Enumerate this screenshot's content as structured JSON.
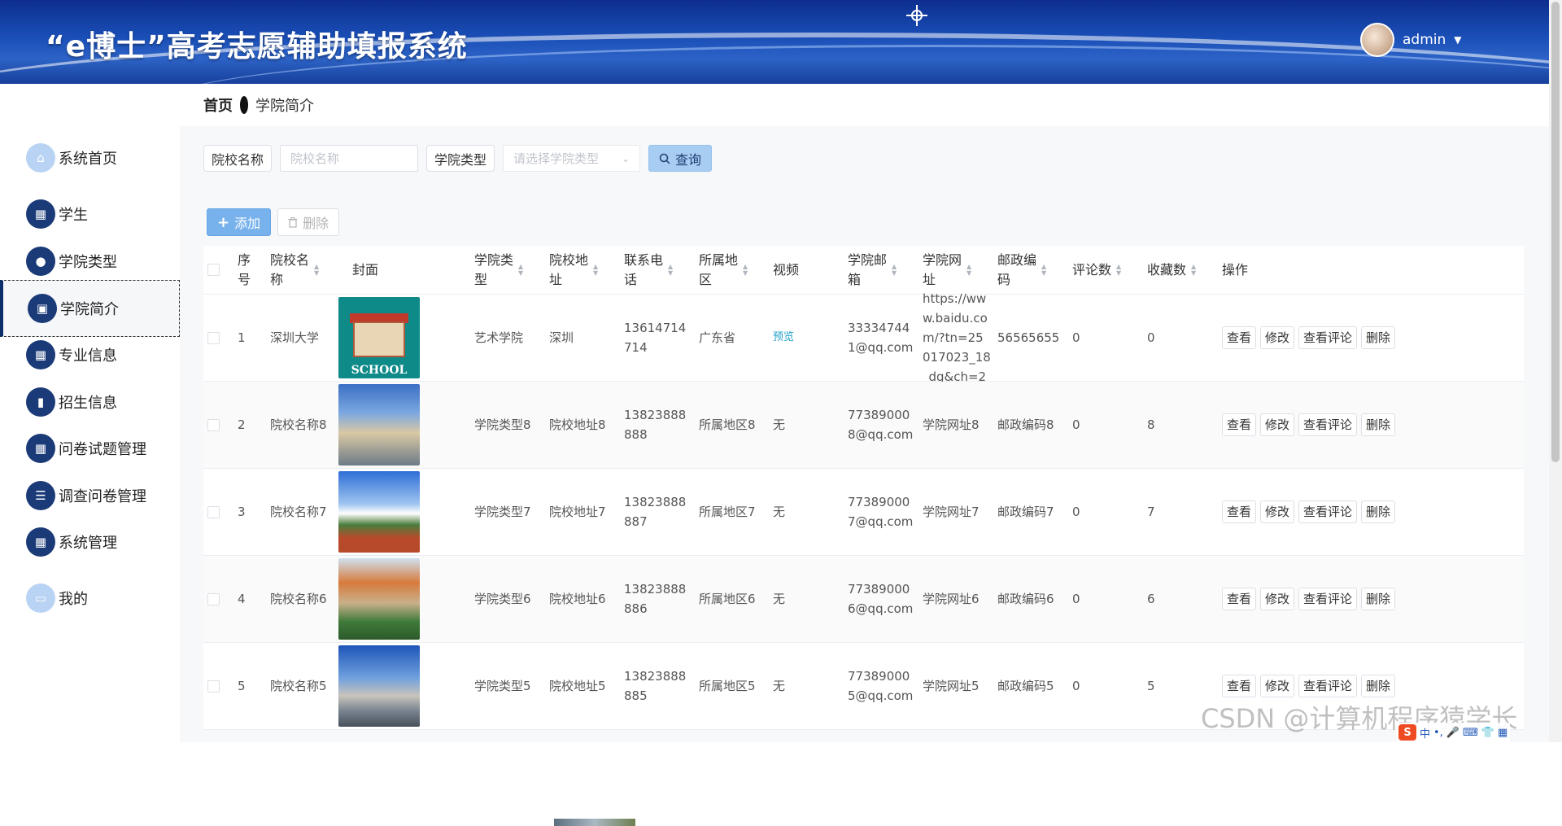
{
  "header": {
    "title": "“e博士”高考志愿辅助填报系统",
    "username": "admin"
  },
  "sidebar": {
    "items": [
      {
        "label": "系统首页",
        "icon": "home-icon"
      },
      {
        "label": "学生",
        "icon": "grid-icon"
      },
      {
        "label": "学院类型",
        "icon": "user-icon"
      },
      {
        "label": "学院简介",
        "icon": "briefcase-icon",
        "active": true
      },
      {
        "label": "专业信息",
        "icon": "grid-icon"
      },
      {
        "label": "招生信息",
        "icon": "pin-icon"
      },
      {
        "label": "问卷试题管理",
        "icon": "grid-icon"
      },
      {
        "label": "调查问卷管理",
        "icon": "sliders-icon"
      },
      {
        "label": "系统管理",
        "icon": "grid-icon"
      },
      {
        "label": "我的",
        "icon": "card-icon"
      }
    ]
  },
  "breadcrumb": {
    "home": "首页",
    "current": "学院简介"
  },
  "search": {
    "name_label": "院校名称",
    "name_placeholder": "院校名称",
    "type_label": "学院类型",
    "type_placeholder": "请选择学院类型",
    "query_label": "查询"
  },
  "actions": {
    "add_label": "添加",
    "delete_label": "删除"
  },
  "table": {
    "headers": {
      "index": "序号",
      "name": "院校名称",
      "cover": "封面",
      "type": "学院类型",
      "address": "院校地址",
      "phone": "联系电话",
      "region": "所属地区",
      "video": "视频",
      "email": "学院邮箱",
      "website": "学院网址",
      "postcode": "邮政编码",
      "comments": "评论数",
      "favorites": "收藏数",
      "operations": "操作"
    },
    "row_actions": {
      "view": "查看",
      "edit": "修改",
      "view_comments": "查看评论",
      "delete": "删除"
    },
    "rows": [
      {
        "index": "1",
        "name": "深圳大学",
        "cover_text": "SCHOOL",
        "type": "艺术学院",
        "address": "深圳",
        "phone": "13614714714",
        "region": "广东省",
        "video": "预览",
        "email": "333347441@qq.com",
        "website": "https://www.baidu.com/?tn=25017023_18_dg&ch=2",
        "postcode": "56565655",
        "comments": "0",
        "favorites": "0"
      },
      {
        "index": "2",
        "name": "院校名称8",
        "type": "学院类型8",
        "address": "院校地址8",
        "phone": "13823888888",
        "region": "所属地区8",
        "video": "无",
        "email": "773890008@qq.com",
        "website": "学院网址8",
        "postcode": "邮政编码8",
        "comments": "0",
        "favorites": "8"
      },
      {
        "index": "3",
        "name": "院校名称7",
        "type": "学院类型7",
        "address": "院校地址7",
        "phone": "13823888887",
        "region": "所属地区7",
        "video": "无",
        "email": "773890007@qq.com",
        "website": "学院网址7",
        "postcode": "邮政编码7",
        "comments": "0",
        "favorites": "7"
      },
      {
        "index": "4",
        "name": "院校名称6",
        "type": "学院类型6",
        "address": "院校地址6",
        "phone": "13823888886",
        "region": "所属地区6",
        "video": "无",
        "email": "773890006@qq.com",
        "website": "学院网址6",
        "postcode": "邮政编码6",
        "comments": "0",
        "favorites": "6"
      },
      {
        "index": "5",
        "name": "院校名称5",
        "type": "学院类型5",
        "address": "院校地址5",
        "phone": "13823888885",
        "region": "所属地区5",
        "video": "无",
        "email": "773890005@qq.com",
        "website": "学院网址5",
        "postcode": "邮政编码5",
        "comments": "0",
        "favorites": "5"
      }
    ]
  },
  "watermark": "CSDN @计算机程序猿学长",
  "ime": {
    "logo": "S",
    "lang": "中"
  }
}
